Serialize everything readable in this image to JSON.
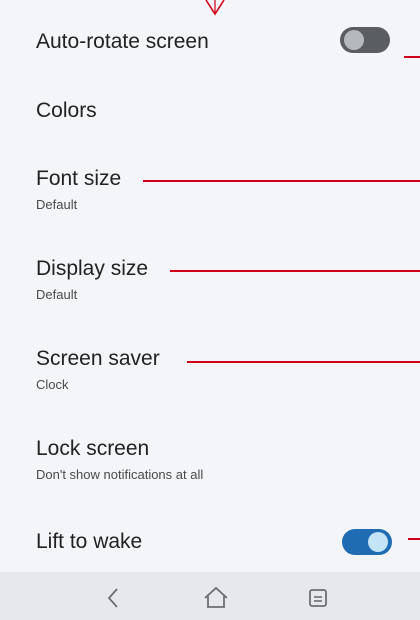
{
  "settings": [
    {
      "title": "Auto-rotate screen",
      "summary": "",
      "toggle": "off"
    },
    {
      "title": "Colors",
      "summary": ""
    },
    {
      "title": "Font size",
      "summary": "Default"
    },
    {
      "title": "Display size",
      "summary": "Default"
    },
    {
      "title": "Screen saver",
      "summary": "Clock"
    },
    {
      "title": "Lock screen",
      "summary": "Don't show notifications at all"
    },
    {
      "title": "Lift to wake",
      "summary": "",
      "toggle": "on"
    }
  ],
  "colors": {
    "annotation": "#d0001b",
    "toggle_on": "#1f6cb3",
    "toggle_off": "#5a5d62",
    "background": "#f3f5f8",
    "navbar": "#e6e8eb"
  },
  "navbar": {
    "buttons": [
      "back-icon",
      "home-icon",
      "recents-icon"
    ]
  }
}
